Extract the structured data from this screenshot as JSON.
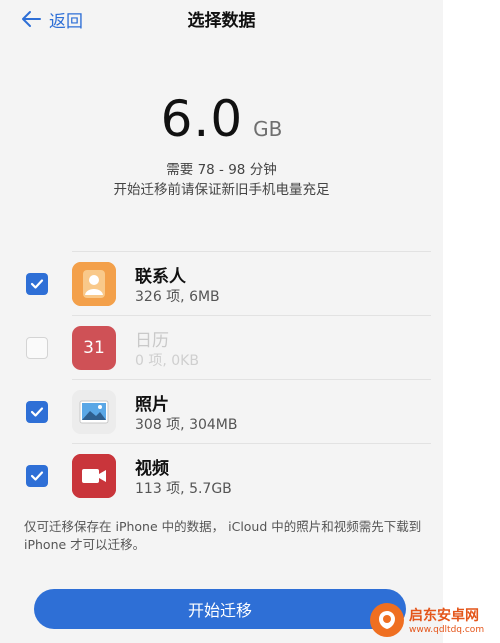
{
  "header": {
    "back_label": "返回",
    "title": "选择数据"
  },
  "summary": {
    "size_value": "6.0",
    "size_unit": "GB",
    "duration": "需要 78 - 98 分钟",
    "battery_note": "开始迁移前请保证新旧手机电量充足"
  },
  "items": [
    {
      "name": "联系人",
      "meta": "326 项, 6MB",
      "checked": true,
      "icon": "contacts-icon"
    },
    {
      "name": "日历",
      "meta": "0 项, 0KB",
      "checked": false,
      "icon": "calendar-icon",
      "icon_text": "31"
    },
    {
      "name": "照片",
      "meta": "308 项, 304MB",
      "checked": true,
      "icon": "photos-icon"
    },
    {
      "name": "视频",
      "meta": "113 项, 5.7GB",
      "checked": true,
      "icon": "video-icon"
    }
  ],
  "footer": {
    "note": "仅可迁移保存在 iPhone 中的数据， iCloud 中的照片和视频需先下载到 iPhone 才可以迁移。",
    "start_label": "开始迁移"
  },
  "watermark": {
    "name": "启东安卓网",
    "url": "www.qdltdq.com"
  },
  "colors": {
    "accent": "#2e6fd6",
    "background": "#f4f4f4",
    "watermark": "#e4551a"
  }
}
